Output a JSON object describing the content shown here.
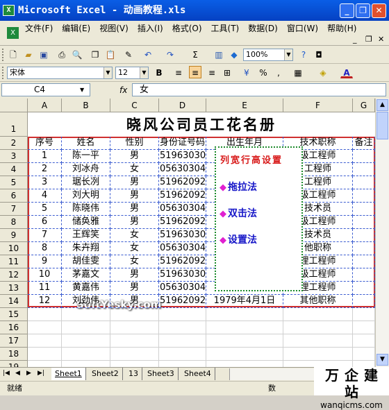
{
  "window": {
    "title": "Microsoft Excel - 动画教程.xls",
    "minimize": "_",
    "restore": "❐",
    "close": "✕"
  },
  "menu": {
    "items": [
      "文件(F)",
      "编辑(E)",
      "视图(V)",
      "插入(I)",
      "格式(O)",
      "工具(T)",
      "数据(D)",
      "窗口(W)",
      "帮助(H)"
    ],
    "mdi_minimize": "_",
    "mdi_restore": "❐",
    "mdi_close": "✕"
  },
  "toolbar": {
    "zoom": "100%",
    "font_name": "宋体",
    "font_size": "12",
    "bold": "B",
    "percent": "%",
    "comma": ","
  },
  "formula_bar": {
    "name_box": "C4",
    "fx": "fx",
    "value": "女"
  },
  "sheet": {
    "columns": [
      "A",
      "B",
      "C",
      "D",
      "E",
      "F",
      "G"
    ],
    "rows": [
      "1",
      "2",
      "3",
      "4",
      "5",
      "6",
      "7",
      "8",
      "9",
      "10",
      "11",
      "12",
      "13",
      "14",
      "15",
      "16",
      "17",
      "18",
      "19"
    ],
    "title": "晓风公司员工花名册",
    "headers": [
      "序号",
      "姓名",
      "性别",
      "身份证号码",
      "出生年月",
      "技术职称",
      "备注"
    ],
    "data": [
      [
        "1",
        "陈一平",
        "男",
        "51963030",
        "",
        "级工程师"
      ],
      [
        "2",
        "刘冰舟",
        "女",
        "05630304",
        "",
        "工程师"
      ],
      [
        "3",
        "琚长冽",
        "男",
        "51962092",
        "",
        "工程师"
      ],
      [
        "4",
        "刘大明",
        "男",
        "51962092",
        "",
        "级工程师"
      ],
      [
        "5",
        "陈晓伟",
        "男",
        "05630304",
        "",
        "技术员"
      ],
      [
        "6",
        "储奂雅",
        "男",
        "51962092",
        "",
        "级工程师"
      ],
      [
        "7",
        "王辉笑",
        "女",
        "51963030",
        "",
        "技术员"
      ],
      [
        "8",
        "朱卉翔",
        "女",
        "05630304",
        "",
        "他职称"
      ],
      [
        "9",
        "胡佳雯",
        "女",
        "51962092",
        "",
        "理工程师"
      ],
      [
        "10",
        "茅嘉文",
        "男",
        "51963030",
        "",
        "级工程师"
      ],
      [
        "11",
        "黄嘉伟",
        "男",
        "05630304",
        "",
        "理工程师"
      ],
      [
        "12",
        "刘劲伟",
        "男",
        "51962092",
        "1979年4月1日",
        "其他职称"
      ]
    ]
  },
  "popup": {
    "title": "列宽行高设置",
    "items": [
      "拖拉法",
      "双击法",
      "设置法"
    ],
    "bullet": "◆"
  },
  "watermark": "SoftYesky.com",
  "tabs": {
    "nav": [
      "|◀",
      "◀",
      "▶",
      "▶|"
    ],
    "sheets": [
      "Sheet1",
      "Sheet2",
      "13",
      "Sheet3",
      "Sheet4"
    ]
  },
  "status": {
    "left": "就绪",
    "num": "数"
  },
  "site": {
    "cn": "万企建站",
    "url": "wanqicms.com"
  }
}
